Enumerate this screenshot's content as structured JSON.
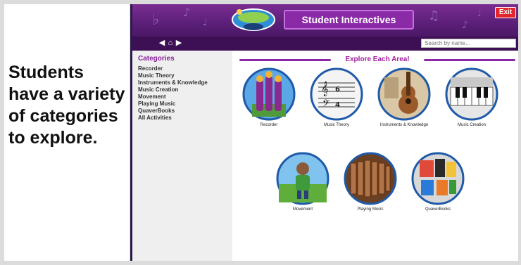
{
  "slide": {
    "caption": "Students have a variety of categories to explore."
  },
  "app": {
    "header": {
      "title": "Student Interactives",
      "exit_label": "Exit"
    },
    "nav": {
      "back_icon": "left-arrow",
      "home_icon": "house",
      "forward_icon": "right-arrow",
      "search_placeholder": "Search by name..."
    },
    "sidebar": {
      "title": "Categories",
      "items": [
        "Recorder",
        "Music Theory",
        "Instruments & Knowledge",
        "Music Creation",
        "Movement",
        "Playing Music",
        "QuaverBooks",
        "All Activities"
      ]
    },
    "main": {
      "heading": "Explore Each Area!",
      "tiles": [
        {
          "label": "Recorder"
        },
        {
          "label": "Music Theory"
        },
        {
          "label": "Instruments & Knowledge"
        },
        {
          "label": "Music Creation"
        },
        {
          "label": "Movement"
        },
        {
          "label": "Playing Music"
        },
        {
          "label": "QuaverBooks"
        }
      ]
    }
  },
  "colors": {
    "header_purple": "#5b1f78",
    "accent_purple": "#8b2aa6",
    "exit_red": "#e3262c",
    "tile_ring": "#1f5aa8"
  }
}
